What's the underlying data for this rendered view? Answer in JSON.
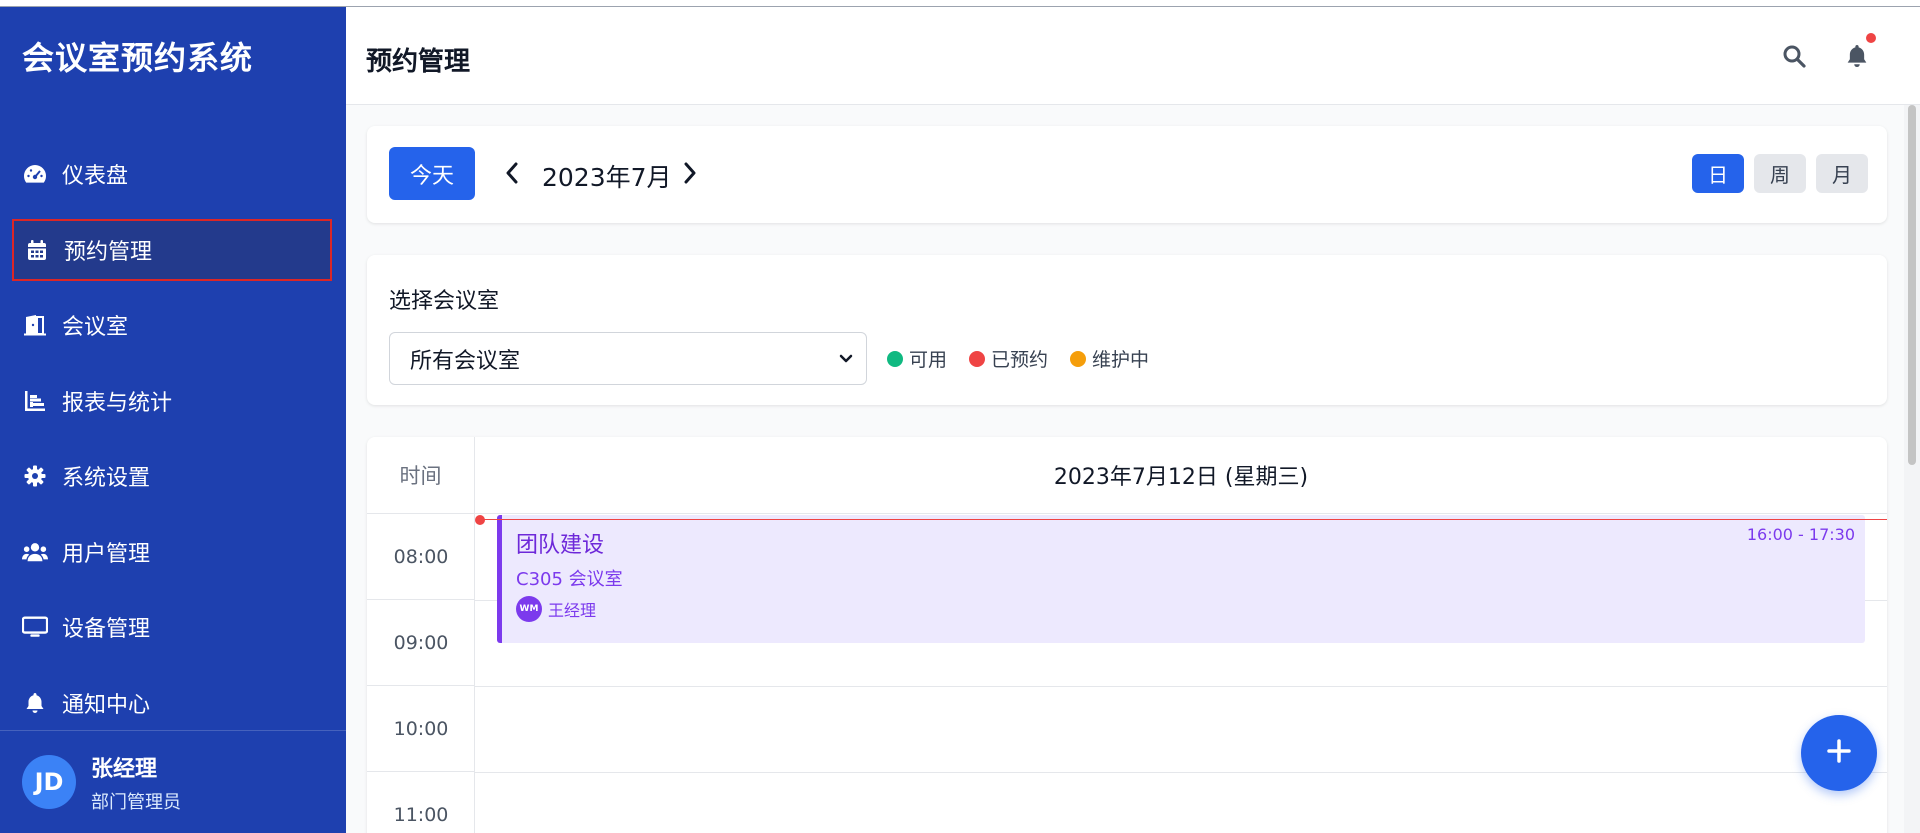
{
  "sidebar": {
    "title": "会议室预约系统",
    "items": [
      {
        "label": "仪表盘",
        "icon": "dashboard-icon"
      },
      {
        "label": "预约管理",
        "icon": "calendar-icon",
        "active": true
      },
      {
        "label": "会议室",
        "icon": "door-icon"
      },
      {
        "label": "报表与统计",
        "icon": "chart-icon"
      },
      {
        "label": "系统设置",
        "icon": "gear-icon"
      },
      {
        "label": "用户管理",
        "icon": "users-icon"
      },
      {
        "label": "设备管理",
        "icon": "monitor-icon"
      },
      {
        "label": "通知中心",
        "icon": "bell-icon"
      }
    ],
    "user": {
      "initials": "JD",
      "name": "张经理",
      "role": "部门管理员"
    }
  },
  "header": {
    "title": "预约管理",
    "icons": [
      "search-icon",
      "bell-icon"
    ]
  },
  "toolbar": {
    "today_label": "今天",
    "current_month": "2023年7月",
    "views": [
      {
        "label": "日",
        "active": true
      },
      {
        "label": "周",
        "active": false
      },
      {
        "label": "月",
        "active": false
      }
    ]
  },
  "filter": {
    "label": "选择会议室",
    "selected": "所有会议室",
    "legend": [
      {
        "label": "可用",
        "color": "#10b981"
      },
      {
        "label": "已预约",
        "color": "#ef4444"
      },
      {
        "label": "维护中",
        "color": "#f59e0b"
      }
    ]
  },
  "calendar": {
    "time_header": "时间",
    "day_header": "2023年7月12日 (星期三)",
    "time_slots": [
      "08:00",
      "09:00",
      "10:00",
      "11:00"
    ],
    "event": {
      "title": "团队建设",
      "time": "16:00 - 17:30",
      "room": "C305 会议室",
      "person_initials": "WM",
      "person_name": "王经理"
    }
  },
  "colors": {
    "sidebar_bg": "#1e40af",
    "accent": "#2563eb",
    "event_bg": "#ede9fe",
    "event_accent": "#7c3aed"
  }
}
